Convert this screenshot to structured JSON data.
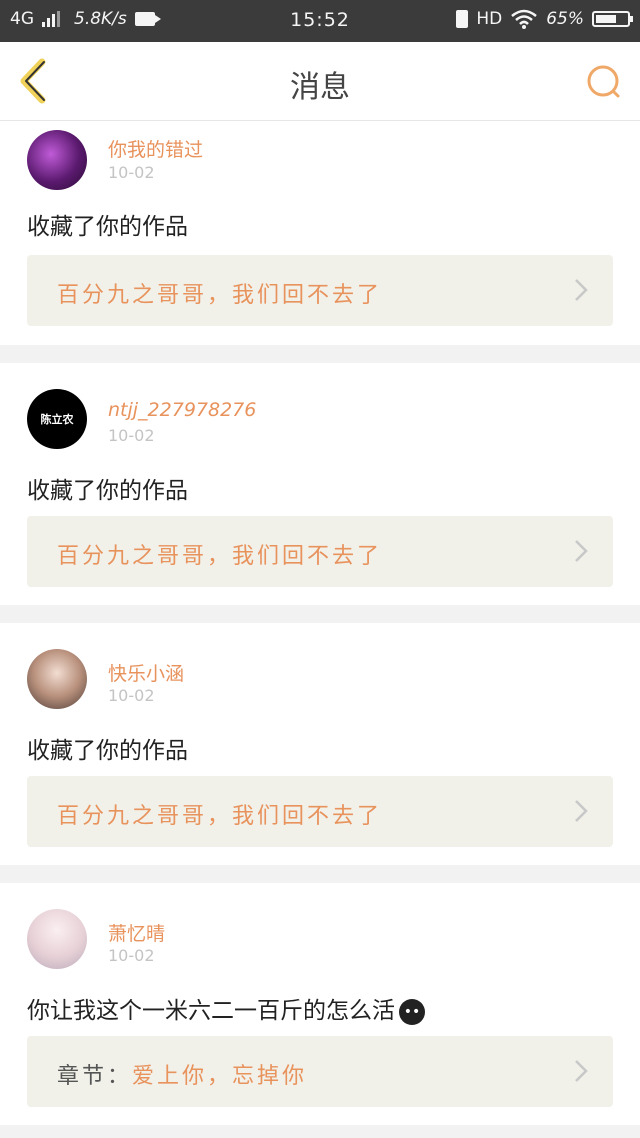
{
  "status_bar": {
    "network": "4G",
    "speed": "5.8K/s",
    "time": "15:52",
    "hd": "HD",
    "battery_percent": "65%",
    "battery_level": 0.65
  },
  "header": {
    "title": "消息"
  },
  "messages": [
    {
      "username": "你我的错过",
      "date": "10-02",
      "action": "收藏了你的作品",
      "ref_prefix": "",
      "ref_text": "百分九之哥哥，我们回不去了",
      "avatar_color": "#6a1f7a"
    },
    {
      "username": "ntjj_227978276",
      "date": "10-02",
      "action": "收藏了你的作品",
      "ref_prefix": "",
      "ref_text": "百分九之哥哥，我们回不去了",
      "avatar_text": "陈立农",
      "avatar_color": "#000000"
    },
    {
      "username": "快乐小涵",
      "date": "10-02",
      "action": "收藏了你的作品",
      "ref_prefix": "",
      "ref_text": "百分九之哥哥，我们回不去了",
      "avatar_color": "#b89a8a"
    },
    {
      "username": "萧忆晴",
      "date": "10-02",
      "action": "你让我这个一米六二一百斤的怎么活",
      "ref_prefix": "章节：",
      "ref_text": "爱上你，忘掉你",
      "avatar_color": "#e8dde0"
    }
  ],
  "colors": {
    "accent": "#e8925c",
    "status_bg": "#3b3b3b",
    "ref_bg": "#f1f1ea"
  }
}
